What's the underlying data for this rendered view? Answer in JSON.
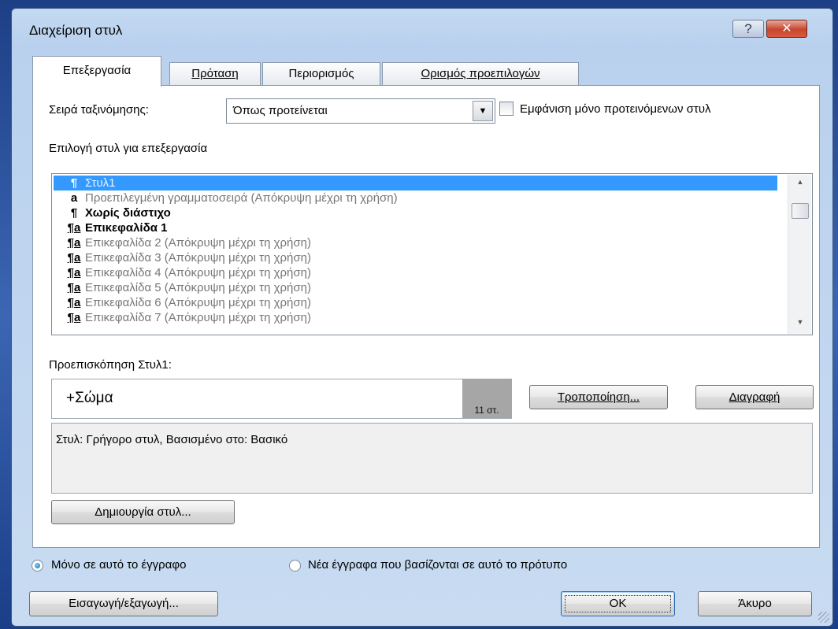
{
  "window": {
    "title": "Διαχείριση στυλ",
    "help_label": "?",
    "close_label": "✕"
  },
  "tabs": [
    {
      "label": "Επεξεργασία",
      "active": true
    },
    {
      "label": "Πρόταση",
      "active": false
    },
    {
      "label": "Περιορισμός",
      "active": false
    },
    {
      "label": "Ορισμός προεπιλογών",
      "active": false
    }
  ],
  "sort": {
    "label": "Σειρά ταξινόμησης:",
    "value": "Όπως προτείνεται",
    "arrow": "▼"
  },
  "show_recommended": {
    "label": "Εμφάνιση μόνο προτεινόμενων στυλ",
    "checked": false
  },
  "style_list": {
    "label": "Επιλογή στυλ για επεξεργασία",
    "items": [
      {
        "glyph": "¶",
        "name": "Στυλ1",
        "hint": "",
        "state": "selected"
      },
      {
        "glyph": "a",
        "name": "Προεπιλεγμένη γραμματοσειρά",
        "hint": " (Απόκρυψη μέχρι τη χρήση)",
        "state": "hidden"
      },
      {
        "glyph": "¶",
        "name": "Χωρίς διάστιχο",
        "hint": "",
        "state": "bold"
      },
      {
        "glyph": "¶a",
        "name": "Επικεφαλίδα 1",
        "hint": "",
        "state": "bold"
      },
      {
        "glyph": "¶a",
        "name": "Επικεφαλίδα 2",
        "hint": " (Απόκρυψη μέχρι τη χρήση)",
        "state": "hidden"
      },
      {
        "glyph": "¶a",
        "name": "Επικεφαλίδα 3",
        "hint": " (Απόκρυψη μέχρι τη χρήση)",
        "state": "hidden"
      },
      {
        "glyph": "¶a",
        "name": "Επικεφαλίδα 4",
        "hint": " (Απόκρυψη μέχρι τη χρήση)",
        "state": "hidden"
      },
      {
        "glyph": "¶a",
        "name": "Επικεφαλίδα 5",
        "hint": " (Απόκρυψη μέχρι τη χρήση)",
        "state": "hidden"
      },
      {
        "glyph": "¶a",
        "name": "Επικεφαλίδα 6",
        "hint": " (Απόκρυψη μέχρι τη χρήση)",
        "state": "hidden"
      },
      {
        "glyph": "¶a",
        "name": "Επικεφαλίδα 7",
        "hint": " (Απόκρυψη μέχρι τη χρήση)",
        "state": "hidden"
      }
    ],
    "scroll_up": "▲",
    "scroll_down": "▼"
  },
  "preview": {
    "label": "Προεπισκόπηση Στυλ1:",
    "font_text": "+Σώμα",
    "size_text": "11 στ."
  },
  "buttons": {
    "modify": "Τροποποίηση...",
    "delete": "Διαγραφή",
    "new_style": "Δημιουργία στυλ...",
    "import_export": "Εισαγωγή/εξαγωγή...",
    "ok": "OK",
    "cancel": "Άκυρο"
  },
  "description": {
    "text": "Στυλ: Γρήγορο στυλ, Βασισμένο στο: Βασικό"
  },
  "scope": {
    "option_doc": "Μόνο σε αυτό το έγγραφο",
    "option_template": "Νέα έγγραφα που βασίζονται σε αυτό το πρότυπο",
    "selected": "document"
  },
  "colors": {
    "selection": "#3399ff",
    "frame": "#c4d9f1",
    "close": "#c8452f"
  }
}
